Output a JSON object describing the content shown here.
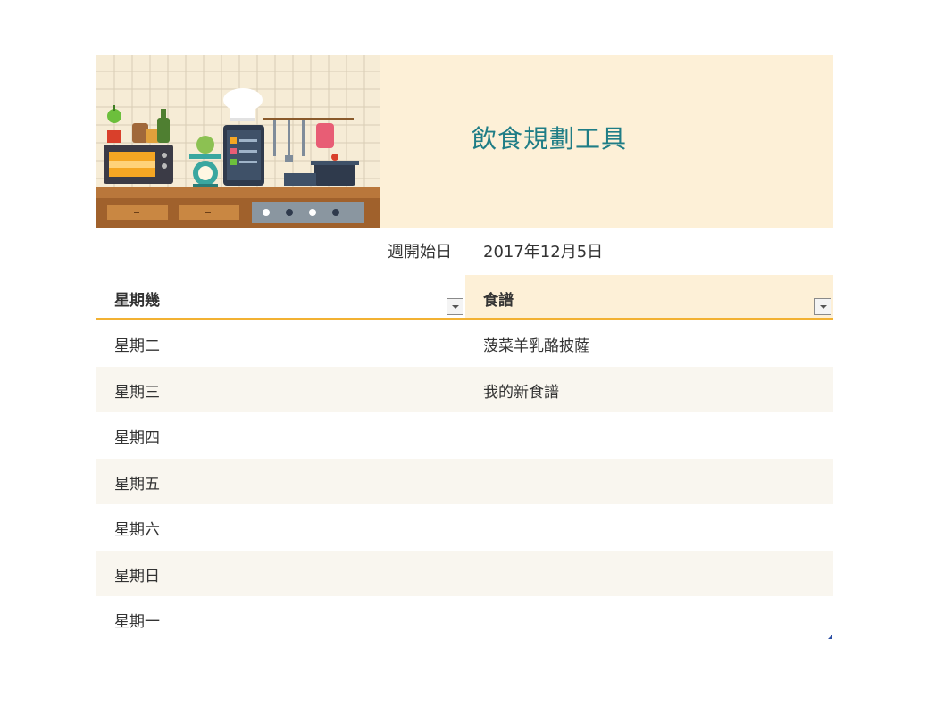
{
  "banner": {
    "title": "飲食規劃工具",
    "colors": {
      "background": "#fdf0d7",
      "title": "#1f7d86"
    },
    "image": {
      "name": "kitchen-illustration",
      "icons": [
        "tile-wall",
        "pepper-icon",
        "jar-icon",
        "bottle-icon",
        "microwave-icon",
        "scale-icon",
        "tablet-recipe-icon",
        "chef-hat-icon",
        "utensil-rack-icon",
        "pot-icon",
        "stove-icon"
      ]
    }
  },
  "week_start": {
    "label": "週開始日",
    "value": "2017年12月5日"
  },
  "table": {
    "headers": {
      "day": "星期幾",
      "recipe": "食譜"
    },
    "accent_color": "#f2b132",
    "rows": [
      {
        "day": "星期二",
        "recipe": "菠菜羊乳酪披薩"
      },
      {
        "day": "星期三",
        "recipe": "我的新食譜"
      },
      {
        "day": "星期四",
        "recipe": ""
      },
      {
        "day": "星期五",
        "recipe": ""
      },
      {
        "day": "星期六",
        "recipe": ""
      },
      {
        "day": "星期日",
        "recipe": ""
      },
      {
        "day": "星期一",
        "recipe": ""
      }
    ]
  }
}
